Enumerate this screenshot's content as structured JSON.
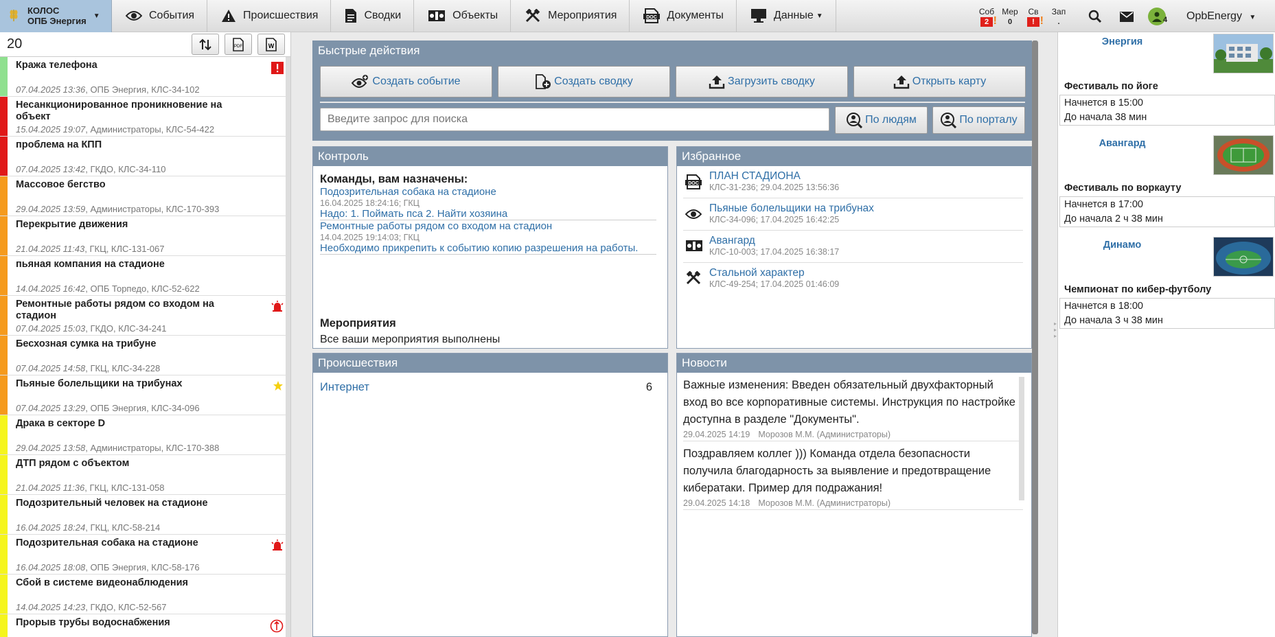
{
  "org": {
    "line1": "КОЛОС",
    "line2": "ОПБ Энергия"
  },
  "nav": [
    {
      "label": "События",
      "icon": "eye-icon"
    },
    {
      "label": "Происшествия",
      "icon": "warning-icon"
    },
    {
      "label": "Сводки",
      "icon": "document-icon"
    },
    {
      "label": "Объекты",
      "icon": "objects-icon"
    },
    {
      "label": "Мероприятия",
      "icon": "tools-icon"
    },
    {
      "label": "Документы",
      "icon": "doc-icon"
    },
    {
      "label": "Данные",
      "icon": "monitor-icon"
    }
  ],
  "counters": [
    {
      "label": "Соб",
      "value": "2",
      "red": true,
      "bang": "!"
    },
    {
      "label": "Мер",
      "value": "0",
      "red": false,
      "bang": ""
    },
    {
      "label": "Св",
      "value": "!",
      "red": true,
      "bang": "!"
    },
    {
      "label": "Зап",
      "value": ".",
      "red": false,
      "bang": ""
    }
  ],
  "user": {
    "name": "OpbEnergy",
    "badge": "4"
  },
  "events_count": "20",
  "events": [
    {
      "title": "Кража телефона",
      "date": "07.04.2025 13:36",
      "meta": ", ОПБ Энергия, КЛС-34-102",
      "color": "#8fe08f",
      "mark": "alert"
    },
    {
      "title": "Несанкционированное проникновение на объект",
      "date": "15.04.2025 19:07",
      "meta": ", Администраторы, КЛС-54-422",
      "color": "#e01818",
      "mark": ""
    },
    {
      "title": "проблема на КПП",
      "date": "07.04.2025 13:42",
      "meta": ", ГКДО, КЛС-34-110",
      "color": "#e01818",
      "mark": ""
    },
    {
      "title": "Массовое бегство",
      "date": "29.04.2025 13:59",
      "meta": ", Администраторы, КЛС-170-393",
      "color": "#f59a1c",
      "mark": ""
    },
    {
      "title": "Перекрытие движения",
      "date": "21.04.2025 11:43",
      "meta": ", ГКЦ, КЛС-131-067",
      "color": "#f59a1c",
      "mark": ""
    },
    {
      "title": "пьяная компания на стадионе",
      "date": "14.04.2025 16:42",
      "meta": ", ОПБ Торпедо, КЛС-52-622",
      "color": "#f59a1c",
      "mark": ""
    },
    {
      "title": "Ремонтные работы рядом со входом на стадион",
      "date": "07.04.2025 15:03",
      "meta": ", ГКДО, КЛС-34-241",
      "color": "#f59a1c",
      "mark": "siren"
    },
    {
      "title": "Бесхозная сумка на трибуне",
      "date": "07.04.2025 14:58",
      "meta": ", ГКЦ, КЛС-34-228",
      "color": "#f59a1c",
      "mark": ""
    },
    {
      "title": "Пьяные болельщики на трибунах",
      "date": "07.04.2025 13:29",
      "meta": ", ОПБ Энергия, КЛС-34-096",
      "color": "#f59a1c",
      "mark": "star"
    },
    {
      "title": "Драка в секторе D",
      "date": "29.04.2025 13:58",
      "meta": ", Администраторы, КЛС-170-388",
      "color": "#f5f51c",
      "mark": ""
    },
    {
      "title": "ДТП рядом с объектом",
      "date": "21.04.2025 11:36",
      "meta": ", ГКЦ, КЛС-131-058",
      "color": "#f5f51c",
      "mark": ""
    },
    {
      "title": "Подозрительный человек на стадионе",
      "date": "16.04.2025 18:24",
      "meta": ", ГКЦ, КЛС-58-214",
      "color": "#f5f51c",
      "mark": ""
    },
    {
      "title": "Подозрительная собака на стадионе",
      "date": "16.04.2025 18:08",
      "meta": ", ОПБ Энергия, КЛС-58-176",
      "color": "#f5f51c",
      "mark": "siren"
    },
    {
      "title": "Сбой в системе видеонаблюдения",
      "date": "14.04.2025 14:23",
      "meta": ", ГКДО, КЛС-52-567",
      "color": "#f5f51c",
      "mark": ""
    },
    {
      "title": "Прорыв трубы водоснабжения",
      "date": "",
      "meta": "",
      "color": "#f5f51c",
      "mark": "circle"
    }
  ],
  "quick": {
    "title": "Быстрые действия",
    "buttons": [
      "Создать событие",
      "Создать сводку",
      "Загрузить сводку",
      "Открыть карту"
    ],
    "search_placeholder": "Введите запрос для поиска",
    "by_people": "По людям",
    "by_portal": "По порталу"
  },
  "control": {
    "title": "Контроль",
    "heading": "Команды, вам назначены:",
    "commands": [
      {
        "title": "Подозрительная собака на стадионе",
        "date": "16.04.2025 18:24:16; ГКЦ",
        "text": "Надо: 1. Поймать пса 2. Найти хозяина"
      },
      {
        "title": "Ремонтные работы рядом со входом на стадион",
        "date": "14.04.2025 19:14:03; ГКЦ",
        "text": "Необходимо прикрепить к событию копию разрешения на работы."
      }
    ],
    "events_title": "Мероприятия",
    "events_text": "Все ваши мероприятия выполнены"
  },
  "favorites": {
    "title": "Избранное",
    "items": [
      {
        "title": "ПЛАН СТАДИОНА",
        "meta": "КЛС-31-236; 29.04.2025 13:56:36",
        "icon": "doc-icon"
      },
      {
        "title": "Пьяные болельщики на трибунах",
        "meta": "КЛС-34-096; 17.04.2025 16:42:25",
        "icon": "eye-icon"
      },
      {
        "title": "Авангард",
        "meta": "КЛС-10-003; 17.04.2025 16:38:17",
        "icon": "objects-icon"
      },
      {
        "title": "Стальной характер",
        "meta": "КЛС-49-254; 17.04.2025 01:46:09",
        "icon": "tools-icon"
      }
    ]
  },
  "incidents": {
    "title": "Происшествия",
    "name": "Интернет",
    "count": "6"
  },
  "news": {
    "title": "Новости",
    "items": [
      {
        "text": "Важные изменения: Введен обязательный двухфакторный вход во все корпоративные системы. Инструкция по настройке доступна в разделе \"Документы\".",
        "date": "29.04.2025 14:19",
        "author": "Морозов М.М. (Администраторы)"
      },
      {
        "text": "Поздравляем коллег ))) Команда отдела безопасности получила благодарность за выявление и предотвращение кибератаки. Пример для подражания!",
        "date": "29.04.2025 14:18",
        "author": "Морозов М.М. (Администраторы)"
      }
    ]
  },
  "venues": [
    {
      "name": "Энергия",
      "event": "Фестиваль по йоге",
      "start": "Начнется в 15:00",
      "left": "До начала 38 мин",
      "thumb": "building"
    },
    {
      "name": "Авангард",
      "event": "Фестиваль по воркауту",
      "start": "Начнется в 17:00",
      "left": "До начала 2 ч 38 мин",
      "thumb": "stadium"
    },
    {
      "name": "Динамо",
      "event": "Чемпионат по кибер-футболу",
      "start": "Начнется в 18:00",
      "left": "До начала 3 ч 38 мин",
      "thumb": "arena"
    }
  ]
}
